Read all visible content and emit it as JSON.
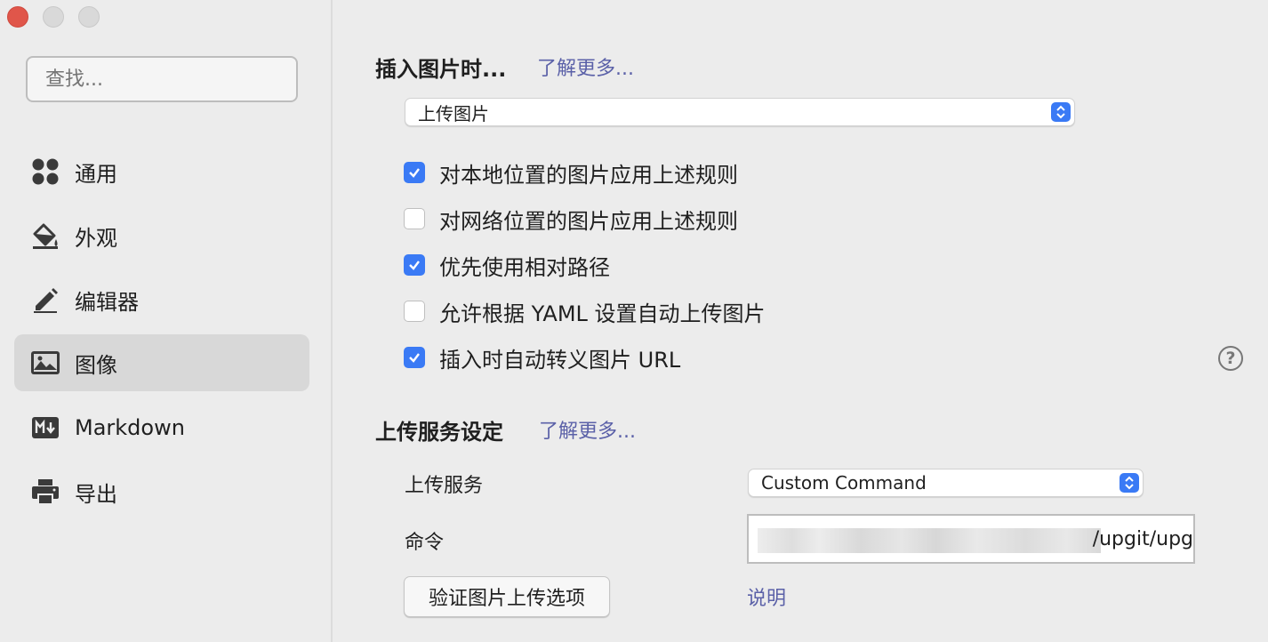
{
  "sidebar": {
    "search_placeholder": "查找...",
    "items": [
      {
        "label": "通用",
        "icon": "apps-icon"
      },
      {
        "label": "外观",
        "icon": "paint-bucket-icon"
      },
      {
        "label": "编辑器",
        "icon": "pencil-icon"
      },
      {
        "label": "图像",
        "icon": "image-icon",
        "active": true
      },
      {
        "label": "Markdown",
        "icon": "markdown-icon"
      },
      {
        "label": "导出",
        "icon": "printer-icon"
      }
    ]
  },
  "image_section": {
    "title": "插入图片时...",
    "learn_more": "了解更多...",
    "insert_action": "上传图片",
    "options": [
      {
        "label": "对本地位置的图片应用上述规则",
        "checked": true
      },
      {
        "label": "对网络位置的图片应用上述规则",
        "checked": false
      },
      {
        "label": "优先使用相对路径",
        "checked": true
      },
      {
        "label": "允许根据 YAML 设置自动上传图片",
        "checked": false
      },
      {
        "label": "插入时自动转义图片 URL",
        "checked": true
      }
    ],
    "help": "?"
  },
  "upload_section": {
    "title": "上传服务设定",
    "learn_more": "了解更多...",
    "service_label": "上传服务",
    "service_value": "Custom Command",
    "command_label": "命令",
    "command_value": "/upgit/upg",
    "verify_button": "验证图片上传选项",
    "explain_link": "说明"
  },
  "colors": {
    "accent": "#3a7af5",
    "link": "#5b61a8",
    "close": "#e0564a"
  }
}
